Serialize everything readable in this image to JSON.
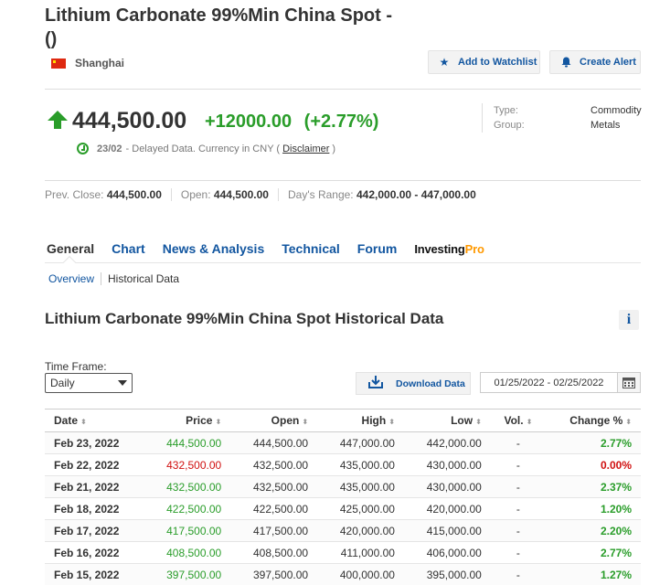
{
  "header": {
    "title": "Lithium Carbonate 99%Min China Spot - ()",
    "location": "Shanghai",
    "watchlist_label": "Add to Watchlist",
    "alert_label": "Create Alert"
  },
  "quote": {
    "price": "444,500.00",
    "change": "+12000.00",
    "change_pct": "(+2.77%)",
    "date": "23/02",
    "delay_text": "- Delayed Data. Currency in CNY (",
    "disclaimer": "Disclaimer",
    "close_paren": ")",
    "type_label": "Type:",
    "type_value": "Commodity",
    "group_label": "Group:",
    "group_value": "Metals"
  },
  "stats": {
    "prev_close_label": "Prev. Close:",
    "prev_close": "444,500.00",
    "open_label": "Open:",
    "open": "444,500.00",
    "range_label": "Day's Range:",
    "range": "442,000.00 - 447,000.00"
  },
  "tabs": {
    "general": "General",
    "chart": "Chart",
    "news": "News & Analysis",
    "technical": "Technical",
    "forum": "Forum",
    "pro_part1": "Investing",
    "pro_part2": "Pro"
  },
  "subtabs": {
    "overview": "Overview",
    "historical": "Historical Data"
  },
  "historical": {
    "title": "Lithium Carbonate 99%Min China Spot Historical Data",
    "info_icon": "i",
    "timeframe_label": "Time Frame:",
    "timeframe_value": "Daily",
    "download_label": "Download Data",
    "date_range": "01/25/2022 - 02/25/2022",
    "columns": [
      "Date",
      "Price",
      "Open",
      "High",
      "Low",
      "Vol.",
      "Change %"
    ],
    "rows": [
      {
        "date": "Feb 23, 2022",
        "price": "444,500.00",
        "open": "444,500.00",
        "high": "447,000.00",
        "low": "442,000.00",
        "vol": "-",
        "change": "2.77%",
        "dir": "up"
      },
      {
        "date": "Feb 22, 2022",
        "price": "432,500.00",
        "open": "432,500.00",
        "high": "435,000.00",
        "low": "430,000.00",
        "vol": "-",
        "change": "0.00%",
        "dir": "down"
      },
      {
        "date": "Feb 21, 2022",
        "price": "432,500.00",
        "open": "432,500.00",
        "high": "435,000.00",
        "low": "430,000.00",
        "vol": "-",
        "change": "2.37%",
        "dir": "up"
      },
      {
        "date": "Feb 18, 2022",
        "price": "422,500.00",
        "open": "422,500.00",
        "high": "425,000.00",
        "low": "420,000.00",
        "vol": "-",
        "change": "1.20%",
        "dir": "up"
      },
      {
        "date": "Feb 17, 2022",
        "price": "417,500.00",
        "open": "417,500.00",
        "high": "420,000.00",
        "low": "415,000.00",
        "vol": "-",
        "change": "2.20%",
        "dir": "up"
      },
      {
        "date": "Feb 16, 2022",
        "price": "408,500.00",
        "open": "408,500.00",
        "high": "411,000.00",
        "low": "406,000.00",
        "vol": "-",
        "change": "2.77%",
        "dir": "up"
      },
      {
        "date": "Feb 15, 2022",
        "price": "397,500.00",
        "open": "397,500.00",
        "high": "400,000.00",
        "low": "395,000.00",
        "vol": "-",
        "change": "1.27%",
        "dir": "up"
      }
    ]
  },
  "colors": {
    "up": "#2a9d2a",
    "down": "#d01010",
    "link": "#1256a0",
    "pro_accent": "#ff9900"
  },
  "icons": {
    "flag": "china-flag-icon",
    "watchlist": "star-icon",
    "alert": "bell-icon",
    "price_direction": "arrow-up-icon",
    "clock": "clock-icon",
    "download": "download-icon",
    "calendar": "calendar-icon",
    "info": "info-icon",
    "sort": "sort-icon"
  }
}
